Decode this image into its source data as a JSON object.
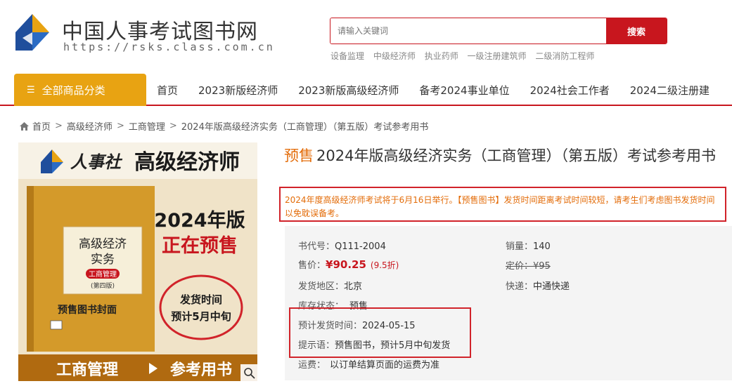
{
  "header": {
    "site_title": "中国人事考试图书网",
    "site_url": "https://rsks.class.com.cn",
    "search_placeholder": "请输入关键词",
    "search_button": "搜索",
    "hot_keywords": [
      "设备监理",
      "中级经济师",
      "执业药师",
      "一级注册建筑师",
      "二级消防工程师"
    ]
  },
  "nav": {
    "category_label": "全部商品分类",
    "items": [
      "首页",
      "2023新版经济师",
      "2023新版高级经济师",
      "备考2024事业单位",
      "2024社会工作者",
      "2024二级注册建"
    ]
  },
  "breadcrumb": [
    "首页",
    "高级经济师",
    "工商管理",
    "2024年版高级经济实务（工商管理）（第五版）考试参考用书"
  ],
  "cover": {
    "brand": "人事社",
    "series": "高级经济师",
    "year_edition": "2024年版",
    "presale_banner": "正在预售",
    "book_title_line1": "高级经济",
    "book_title_line2": "实务",
    "book_subject": "工商管理",
    "book_edition": "(第四版)",
    "cover_caption": "预售图书封面",
    "circle_line1": "发货时间",
    "circle_line2": "预计5月中旬",
    "bottom_left": "工商管理",
    "bottom_right": "参考用书"
  },
  "product": {
    "presale_tag": "预售",
    "title": "2024年版高级经济实务（工商管理）（第五版）考试参考用书",
    "notice": "2024年度高级经济师考试将于6月16日举行。【预售图书】发货时间距离考试时间较短，请考生们考虑图书发货时间以免耽误备考。",
    "book_code_label": "书代号：",
    "book_code": "Q111-2004",
    "sales_label": "销量：",
    "sales": "140",
    "price_label": "售价：",
    "price": "¥90.25",
    "discount": "(9.5折)",
    "list_price_label": "定价：",
    "list_price": "¥95",
    "ship_from_label": "发货地区：",
    "ship_from": "北京",
    "courier_label": "快递：",
    "courier": "中通快递",
    "stock_label": "库存状态：",
    "stock": "预售",
    "est_ship_label": "预计发货时间：",
    "est_ship": "2024-05-15",
    "tip_label": "提示语：",
    "tip": "预售图书，预计5月中旬发货",
    "freight_label": "运费：",
    "freight": "以订单结算页面的运费为准"
  },
  "colors": {
    "brand_red": "#c8161e",
    "accent_orange": "#e8a312",
    "notice_orange": "#e36c09"
  }
}
